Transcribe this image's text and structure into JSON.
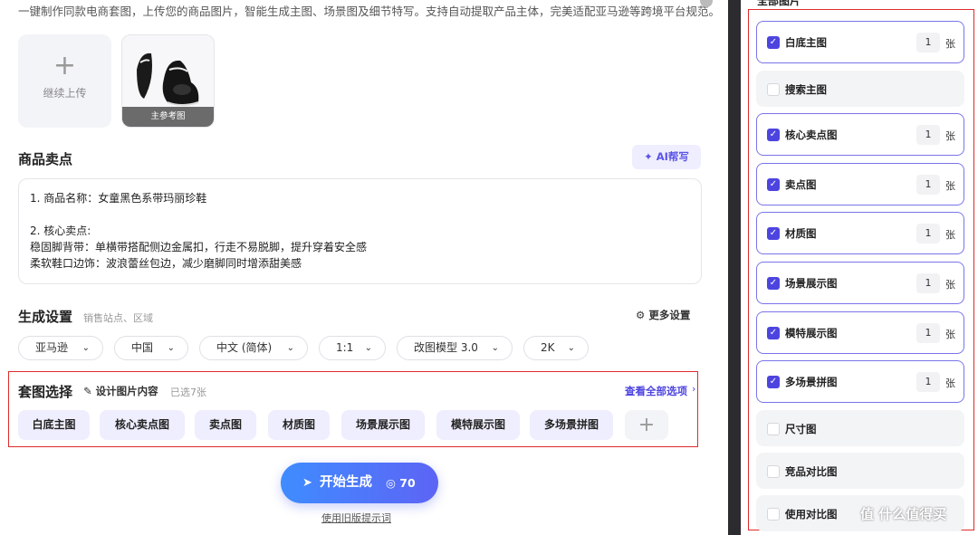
{
  "intro": "一键制作同款电商套图，上传您的商品图片，智能生成主图、场景图及细节特写。支持自动提取产品主体，完美适配亚马逊等跨境平台规范。",
  "upload": {
    "label": "继续上传",
    "thumb_tag": "主参考图"
  },
  "selling": {
    "title": "商品卖点",
    "ai_button": "AI帮写",
    "lines": [
      "1. 商品名称：女童黑色系带玛丽珍鞋",
      "",
      "2. 核心卖点:",
      "稳固脚背带：单横带搭配侧边金属扣，行走不易脱脚，提升穿着安全感",
      "柔软鞋口边饰：波浪蕾丝包边，减少磨脚同时增添甜美感"
    ]
  },
  "settings": {
    "title": "生成设置",
    "hint": "销售站点、区域",
    "more": "更多设置",
    "pills": [
      "亚马逊",
      "中国",
      "中文 (简体)",
      "1:1",
      "改图模型 3.0",
      "2K"
    ]
  },
  "set_selection": {
    "title": "套图选择",
    "design_link": "设计图片内容",
    "selected": "已选7张",
    "view_all": "查看全部选项",
    "chips": [
      "白底主图",
      "核心卖点图",
      "卖点图",
      "材质图",
      "场景展示图",
      "模特展示图",
      "多场景拼图"
    ]
  },
  "generate": {
    "label": "开始生成",
    "cost": "70",
    "old_link": "使用旧版提示词"
  },
  "right_panel": {
    "header": "全部图片",
    "unit": "张",
    "options": [
      {
        "label": "白底主图",
        "checked": true,
        "qty": "1"
      },
      {
        "label": "搜索主图",
        "checked": false
      },
      {
        "label": "核心卖点图",
        "checked": true,
        "qty": "1"
      },
      {
        "label": "卖点图",
        "checked": true,
        "qty": "1"
      },
      {
        "label": "材质图",
        "checked": true,
        "qty": "1"
      },
      {
        "label": "场景展示图",
        "checked": true,
        "qty": "1"
      },
      {
        "label": "模特展示图",
        "checked": true,
        "qty": "1"
      },
      {
        "label": "多场景拼图",
        "checked": true,
        "qty": "1"
      },
      {
        "label": "尺寸图",
        "checked": false
      },
      {
        "label": "竞品对比图",
        "checked": false
      },
      {
        "label": "使用对比图",
        "checked": false
      }
    ]
  },
  "watermark": "值 什么值得买",
  "colors": {
    "accent": "#4d44e0",
    "highlight": "#e02a2a",
    "chip_bg": "#eeeefe"
  }
}
